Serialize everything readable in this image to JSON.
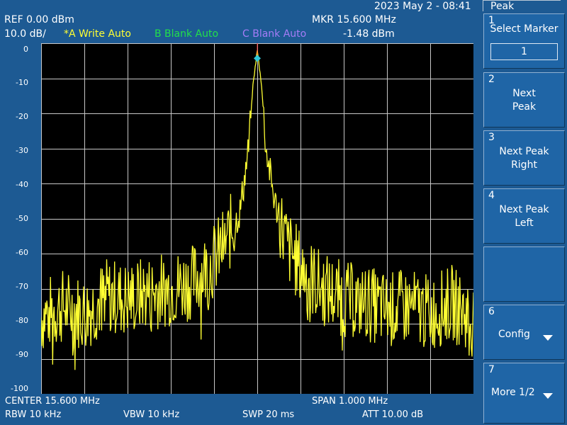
{
  "header": {
    "datetime": "2023 May 2 - 08:41",
    "ref": "REF  0.00 dBm",
    "scale": "10.0 dB/",
    "trace_a": "*A Write Auto",
    "trace_b": "B Blank Auto",
    "trace_c": "C Blank Auto",
    "marker_freq": "MKR 15.600 MHz",
    "marker_level": "-1.48 dBm"
  },
  "y_axis_labels": [
    "0",
    "-10",
    "-20",
    "-30",
    "-40",
    "-50",
    "-60",
    "-70",
    "-80",
    "-90",
    "-100"
  ],
  "footer": {
    "center": "CENTER 15.600 MHz",
    "span": "SPAN 1.000 MHz",
    "rbw": "RBW  10 kHz",
    "vbw": "VBW  10 kHz",
    "swp": "SWP  20 ms",
    "att": "ATT  10.00 dB"
  },
  "panel": {
    "title": "Peak",
    "keys": [
      {
        "num": "1",
        "label": "Select Marker",
        "value": "1"
      },
      {
        "num": "2",
        "label_lines": [
          "Next",
          "Peak"
        ]
      },
      {
        "num": "3",
        "label_lines": [
          "Next Peak",
          "Right"
        ]
      },
      {
        "num": "4",
        "label_lines": [
          "Next Peak",
          "Left"
        ]
      },
      {
        "num": "",
        "label_lines": []
      },
      {
        "num": "6",
        "label": "Config",
        "arrow": true
      },
      {
        "num": "7",
        "label": "More 1/2",
        "arrow": true
      }
    ]
  },
  "colors": {
    "background": "#1d5a93",
    "trace": "#ffff33",
    "grid": "#c8c8c8",
    "marker": "#2ec8d8",
    "screen": "#000000"
  },
  "chart_data": {
    "type": "line",
    "x_range_mhz": [
      15.1,
      16.1
    ],
    "ylim": [
      -100,
      0
    ],
    "grid": true,
    "peak": {
      "x_mhz": 15.6,
      "y_dbm": -1.48
    },
    "series": [
      {
        "x": [
          15.1,
          15.15,
          15.2,
          15.25,
          15.3,
          15.35,
          15.4,
          15.45,
          15.5,
          15.53,
          15.56,
          15.58,
          15.59,
          15.6,
          15.61,
          15.62,
          15.64,
          15.67,
          15.7,
          15.75,
          15.8,
          15.85,
          15.9,
          15.95,
          16.0,
          16.05,
          16.1
        ],
        "y": [
          -78,
          -75,
          -77,
          -72,
          -73,
          -71,
          -70,
          -68,
          -62,
          -56,
          -48,
          -30,
          -12,
          -2,
          -12,
          -30,
          -45,
          -58,
          -64,
          -70,
          -73,
          -74,
          -76,
          -75,
          -77,
          -74,
          -79
        ]
      }
    ]
  }
}
